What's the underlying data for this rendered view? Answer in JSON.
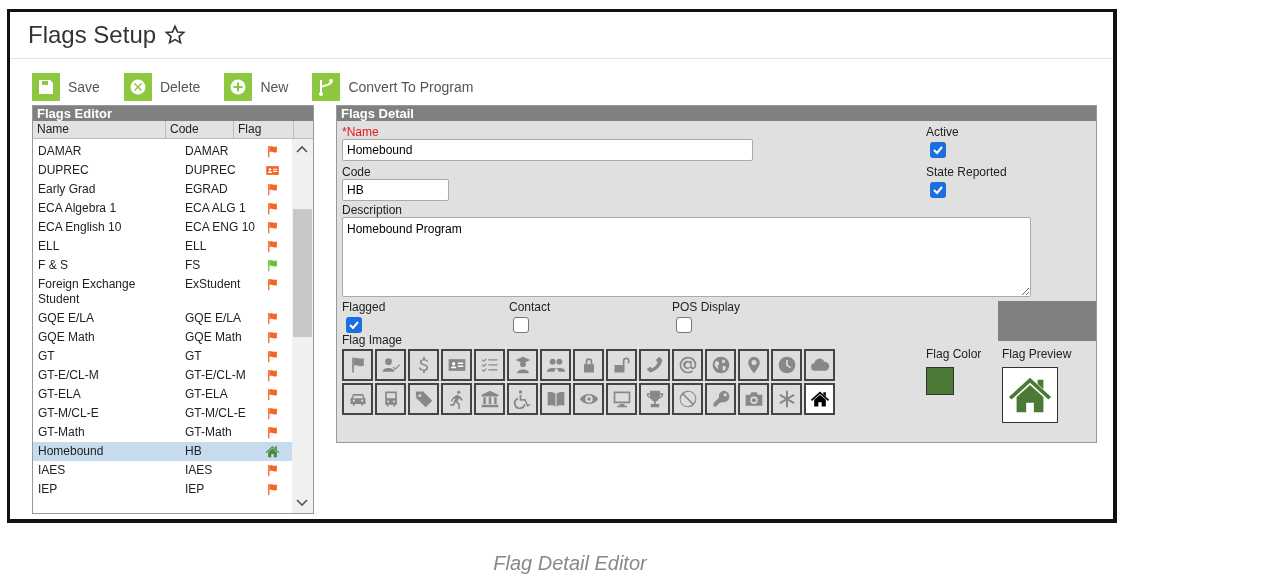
{
  "page": {
    "title": "Flags Setup"
  },
  "toolbar": [
    {
      "label": "Save",
      "kind": "save"
    },
    {
      "label": "Delete",
      "kind": "delete"
    },
    {
      "label": "New",
      "kind": "new"
    },
    {
      "label": "Convert To Program",
      "kind": "convert"
    }
  ],
  "flags_editor": {
    "title": "Flags Editor",
    "columns": [
      "Name",
      "Code",
      "Flag"
    ],
    "rows": [
      {
        "name": "DAMAR",
        "code": "DAMAR",
        "kind": "flag",
        "color": "#f26522",
        "selected": false
      },
      {
        "name": "DUPREC",
        "code": "DUPREC",
        "kind": "id-card",
        "color": "#f26522",
        "selected": false
      },
      {
        "name": "Early Grad",
        "code": "EGRAD",
        "kind": "flag",
        "color": "#f26522",
        "selected": false
      },
      {
        "name": "ECA Algebra 1",
        "code": "ECA ALG 1",
        "kind": "flag",
        "color": "#f26522",
        "selected": false
      },
      {
        "name": "ECA English 10",
        "code": "ECA ENG 10",
        "kind": "flag",
        "color": "#f26522",
        "selected": false
      },
      {
        "name": "ELL",
        "code": "ELL",
        "kind": "flag",
        "color": "#f26522",
        "selected": false
      },
      {
        "name": "F & S",
        "code": "FS",
        "kind": "flag",
        "color": "#6abf3c",
        "selected": false
      },
      {
        "name": "Foreign Exchange Student",
        "code": "ExStudent",
        "kind": "flag",
        "color": "#f26522",
        "selected": false
      },
      {
        "name": "GQE E/LA",
        "code": "GQE E/LA",
        "kind": "flag",
        "color": "#f26522",
        "selected": false
      },
      {
        "name": "GQE Math",
        "code": "GQE Math",
        "kind": "flag",
        "color": "#f26522",
        "selected": false
      },
      {
        "name": "GT",
        "code": "GT",
        "kind": "flag",
        "color": "#f26522",
        "selected": false
      },
      {
        "name": "GT-E/CL-M",
        "code": "GT-E/CL-M",
        "kind": "flag",
        "color": "#f26522",
        "selected": false
      },
      {
        "name": "GT-ELA",
        "code": "GT-ELA",
        "kind": "flag",
        "color": "#f26522",
        "selected": false
      },
      {
        "name": "GT-M/CL-E",
        "code": "GT-M/CL-E",
        "kind": "flag",
        "color": "#f26522",
        "selected": false
      },
      {
        "name": "GT-Math",
        "code": "GT-Math",
        "kind": "flag",
        "color": "#f26522",
        "selected": false
      },
      {
        "name": "Homebound",
        "code": "HB",
        "kind": "home",
        "color": "#4a8a3a",
        "selected": true
      },
      {
        "name": "IAES",
        "code": "IAES",
        "kind": "flag",
        "color": "#f26522",
        "selected": false
      },
      {
        "name": "IEP",
        "code": "IEP",
        "kind": "flag",
        "color": "#f26522",
        "selected": false
      }
    ]
  },
  "flags_detail": {
    "title": "Flags Detail",
    "name_label": "*Name",
    "name_value": "Homebound",
    "code_label": "Code",
    "code_value": "HB",
    "description_label": "Description",
    "description_value": "Homebound Program",
    "active_label": "Active",
    "active": true,
    "state_reported_label": "State Reported",
    "state_reported": true,
    "options": [
      {
        "label": "Flagged",
        "checked": true
      },
      {
        "label": "Contact",
        "checked": false
      },
      {
        "label": "POS Display",
        "checked": false
      }
    ],
    "flag_image_label": "Flag Image",
    "flag_images": [
      {
        "kind": "flag",
        "selected": false
      },
      {
        "kind": "user-check",
        "selected": false
      },
      {
        "kind": "dollar",
        "selected": false
      },
      {
        "kind": "id-card",
        "selected": false
      },
      {
        "kind": "checklist",
        "selected": false
      },
      {
        "kind": "graduate",
        "selected": false
      },
      {
        "kind": "users",
        "selected": false
      },
      {
        "kind": "lock",
        "selected": false
      },
      {
        "kind": "unlock",
        "selected": false
      },
      {
        "kind": "phone",
        "selected": false
      },
      {
        "kind": "at",
        "selected": false
      },
      {
        "kind": "globe",
        "selected": false
      },
      {
        "kind": "pin",
        "selected": false
      },
      {
        "kind": "clock",
        "selected": false
      },
      {
        "kind": "cloud",
        "selected": false
      },
      {
        "kind": "car",
        "selected": false
      },
      {
        "kind": "bus",
        "selected": false
      },
      {
        "kind": "tag",
        "selected": false
      },
      {
        "kind": "runner",
        "selected": false
      },
      {
        "kind": "bank",
        "selected": false
      },
      {
        "kind": "wheelchair",
        "selected": false
      },
      {
        "kind": "book",
        "selected": false
      },
      {
        "kind": "eye",
        "selected": false
      },
      {
        "kind": "monitor",
        "selected": false
      },
      {
        "kind": "trophy",
        "selected": false
      },
      {
        "kind": "ban",
        "selected": false
      },
      {
        "kind": "key",
        "selected": false
      },
      {
        "kind": "camera",
        "selected": false
      },
      {
        "kind": "asterisk",
        "selected": false
      },
      {
        "kind": "home",
        "selected": true
      }
    ],
    "flag_color": {
      "label": "Flag Color",
      "color": "#4a7a35"
    },
    "flag_preview_label": "Flag Preview"
  },
  "caption": "Flag Detail Editor"
}
